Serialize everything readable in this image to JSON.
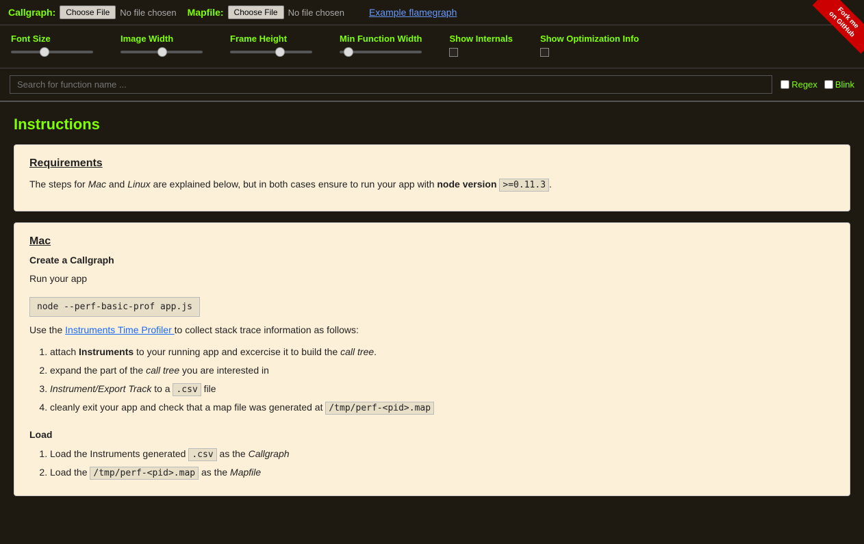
{
  "topbar": {
    "callgraph_label": "Callgraph:",
    "callgraph_button": "Choose File",
    "callgraph_no_file": "No file chosen",
    "mapfile_label": "Mapfile:",
    "mapfile_button": "Choose File",
    "mapfile_no_file": "No file chosen",
    "example_link": "Example flamegraph",
    "fork_line1": "Fork me on GitHub"
  },
  "controls": {
    "font_size_label": "Font Size",
    "image_width_label": "Image Width",
    "frame_height_label": "Frame Height",
    "min_function_width_label": "Min Function Width",
    "show_internals_label": "Show Internals",
    "show_optimization_label": "Show Optimization Info",
    "font_size_position": 35,
    "image_width_position": 45,
    "frame_height_position": 55,
    "min_function_width_position": 10
  },
  "search": {
    "placeholder": "Search for function name ...",
    "regex_label": "Regex",
    "blink_label": "Blink"
  },
  "instructions": {
    "title": "Instructions",
    "requirements": {
      "heading": "Requirements",
      "text_before": "The steps for ",
      "mac_text": "Mac",
      "and_text": " and ",
      "linux_text": "Linux",
      "text_after": " are explained below, but in both cases ensure to run your app with ",
      "node_text": "node version",
      "version_code": ">=0.11.3",
      "period": "."
    },
    "mac": {
      "heading": "Mac",
      "create_heading": "Create a Callgraph",
      "run_app_text": "Run your app",
      "command": "node --perf-basic-prof app.js",
      "use_text": "Use the ",
      "instruments_link": "Instruments Time Profiler ",
      "collect_text": "to collect stack trace information as follows:",
      "steps": [
        "attach Instruments to your running app and excercise it to build the call tree.",
        "expand the part of the call tree you are interested in",
        "Instrument/Export Track to a .csv file",
        "cleanly exit your app and check that a map file was generated at /tmp/perf-<pid>.map"
      ],
      "load_heading": "Load",
      "load_steps": [
        "Load the Instruments generated .csv as the Callgraph",
        "Load the /tmp/perf-<pid>.map as the Mapfile"
      ]
    }
  }
}
